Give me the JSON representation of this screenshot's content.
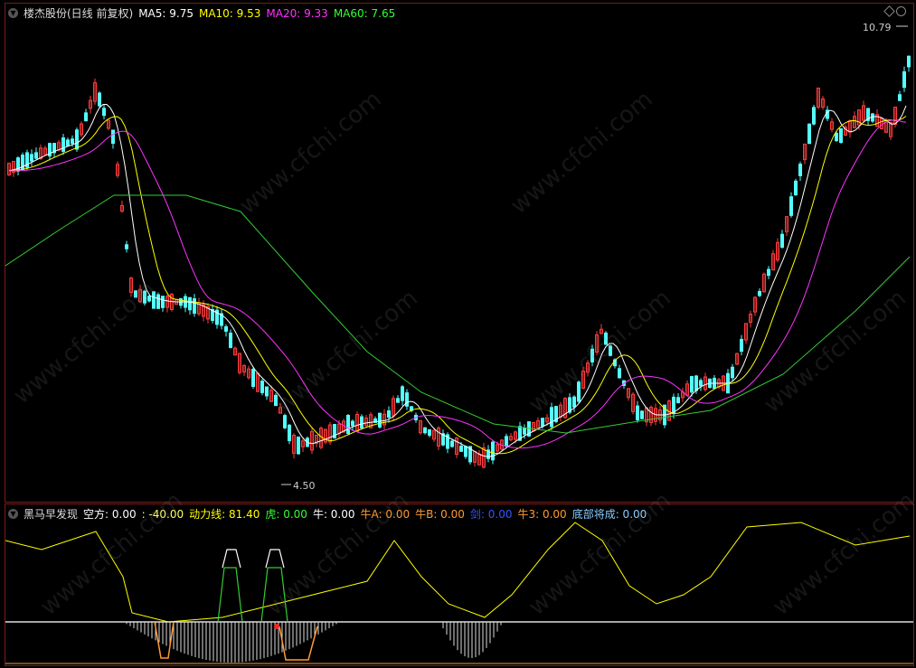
{
  "main": {
    "title": "楼杰股份(日线 前复权)",
    "indicators": [
      {
        "label": "MA5: 9.75",
        "color": "#ffffff"
      },
      {
        "label": "MA10: 9.53",
        "color": "#ffff00"
      },
      {
        "label": "MA20: 9.33",
        "color": "#ff33ff"
      },
      {
        "label": "MA60: 7.65",
        "color": "#33ff33"
      }
    ],
    "high_label": "10.79",
    "low_label": "4.50"
  },
  "sub": {
    "title": "黑马早发现",
    "indicators": [
      {
        "label": "空方: 0.00",
        "color": "#ffffff"
      },
      {
        "label": ": -40.00",
        "color": "#ffff66"
      },
      {
        "label": "动力线: 81.40",
        "color": "#ffff00"
      },
      {
        "label": "虎: 0.00",
        "color": "#33ff33"
      },
      {
        "label": "牛: 0.00",
        "color": "#ffffff"
      },
      {
        "label": "牛A: 0.00",
        "color": "#ff9933"
      },
      {
        "label": "牛B: 0.00",
        "color": "#ff9933"
      },
      {
        "label": "剑: 0.00",
        "color": "#3355ff"
      },
      {
        "label": "牛3: 0.00",
        "color": "#ff9933"
      },
      {
        "label": "底部将成: 0.00",
        "color": "#88ccff"
      }
    ]
  },
  "watermark": "www.cfchi.com",
  "colors": {
    "up": "#ff3c3c",
    "down": "#54ffff",
    "ma5": "#ffffff",
    "ma10": "#ffff00",
    "ma20": "#ff33ff",
    "ma60": "#33cc33",
    "power": "#ffff00",
    "border": "#7a1a1a"
  }
}
